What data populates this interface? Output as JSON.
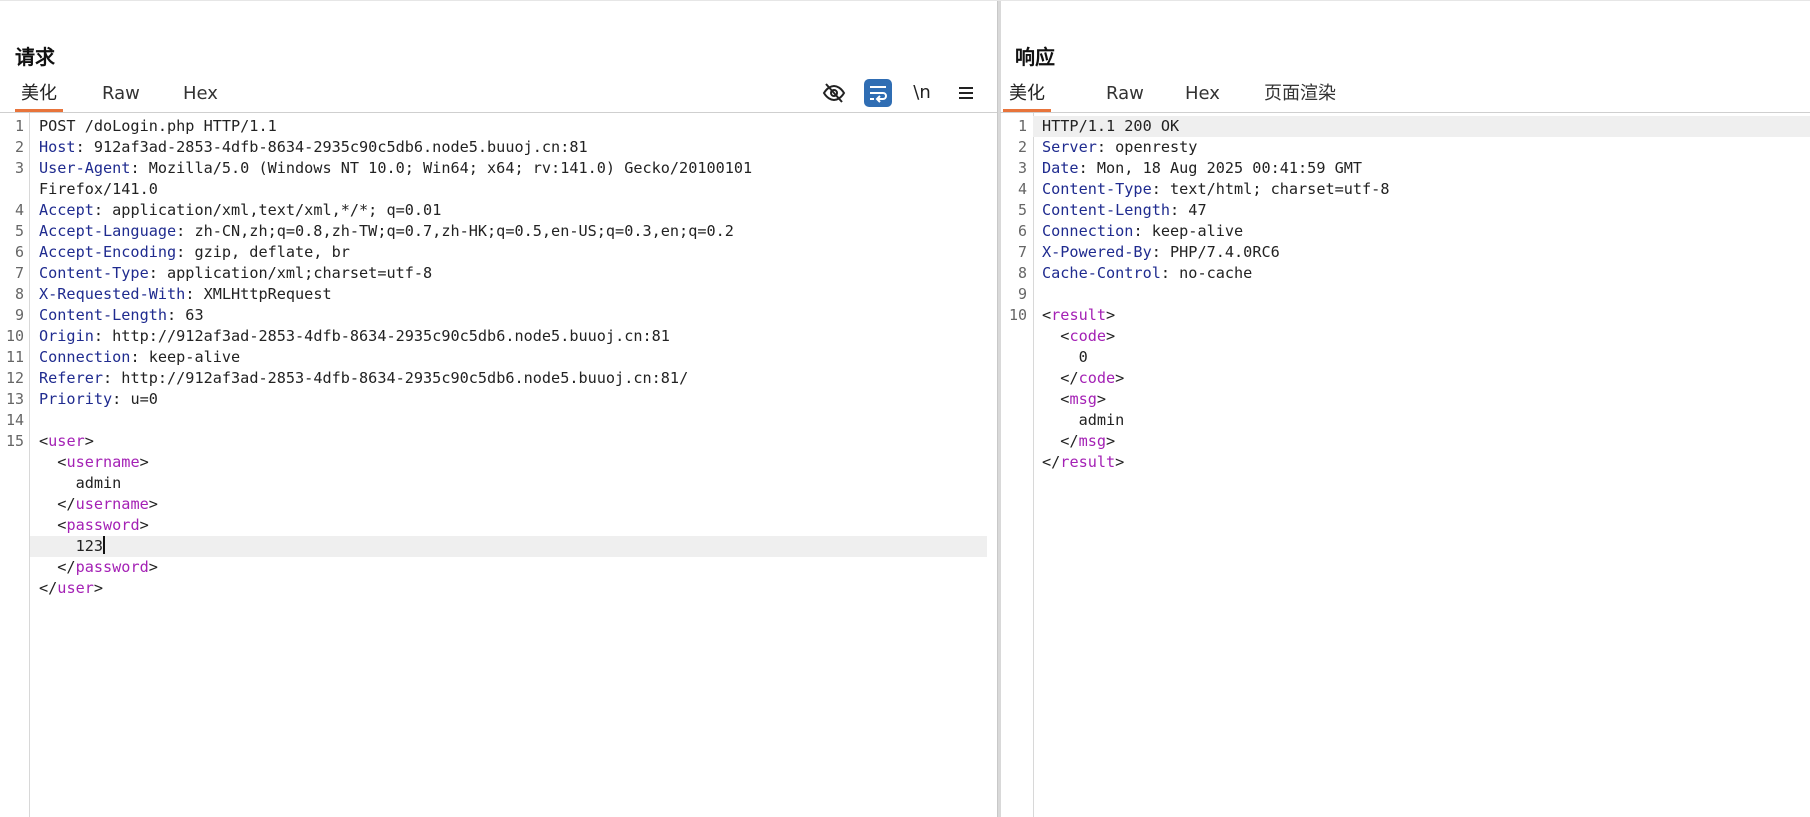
{
  "request": {
    "title": "请求",
    "tabs": [
      "美化",
      "Raw",
      "Hex"
    ],
    "toolbar": {
      "newline_label": "\\n"
    },
    "line_numbers": [
      "1",
      "2",
      "3",
      "4",
      "5",
      "6",
      "7",
      "8",
      "9",
      "10",
      "11",
      "12",
      "13",
      "14",
      "15"
    ],
    "request_line": "POST /doLogin.php HTTP/1.1",
    "headers": [
      {
        "name": "Host",
        "value": ": 912af3ad-2853-4dfb-8634-2935c90c5db6.node5.buuoj.cn:81"
      },
      {
        "name": "User-Agent",
        "value": ": Mozilla/5.0 (Windows NT 10.0; Win64; x64; rv:141.0) Gecko/20100101"
      },
      {
        "name": "Accept",
        "value": ": application/xml,text/xml,*/*; q=0.01"
      },
      {
        "name": "Accept-Language",
        "value": ": zh-CN,zh;q=0.8,zh-TW;q=0.7,zh-HK;q=0.5,en-US;q=0.3,en;q=0.2"
      },
      {
        "name": "Accept-Encoding",
        "value": ": gzip, deflate, br"
      },
      {
        "name": "Content-Type",
        "value": ": application/xml;charset=utf-8"
      },
      {
        "name": "X-Requested-With",
        "value": ": XMLHttpRequest"
      },
      {
        "name": "Content-Length",
        "value": ": 63"
      },
      {
        "name": "Origin",
        "value": ": http://912af3ad-2853-4dfb-8634-2935c90c5db6.node5.buuoj.cn:81"
      },
      {
        "name": "Connection",
        "value": ": keep-alive"
      },
      {
        "name": "Referer",
        "value": ": http://912af3ad-2853-4dfb-8634-2935c90c5db6.node5.buuoj.cn:81/"
      },
      {
        "name": "Priority",
        "value": ": u=0"
      }
    ],
    "ua_continuation": "Firefox/141.0",
    "body": {
      "root": "user",
      "username_tag": "username",
      "username": "admin",
      "password_tag": "password",
      "password": "123"
    }
  },
  "response": {
    "title": "响应",
    "tabs": [
      "美化",
      "Raw",
      "Hex",
      "页面渲染"
    ],
    "line_numbers": [
      "1",
      "2",
      "3",
      "4",
      "5",
      "6",
      "7",
      "8",
      "9",
      "10"
    ],
    "status_line": "HTTP/1.1 200 OK",
    "headers": [
      {
        "name": "Server",
        "value": ": openresty"
      },
      {
        "name": "Date",
        "value": ": Mon, 18 Aug 2025 00:41:59 GMT"
      },
      {
        "name": "Content-Type",
        "value": ": text/html; charset=utf-8"
      },
      {
        "name": "Content-Length",
        "value": ": 47"
      },
      {
        "name": "Connection",
        "value": ": keep-alive"
      },
      {
        "name": "X-Powered-By",
        "value": ": PHP/7.4.0RC6"
      },
      {
        "name": "Cache-Control",
        "value": ": no-cache"
      }
    ],
    "body": {
      "root": "result",
      "code_tag": "code",
      "code": "0",
      "msg_tag": "msg",
      "msg": "admin"
    }
  }
}
